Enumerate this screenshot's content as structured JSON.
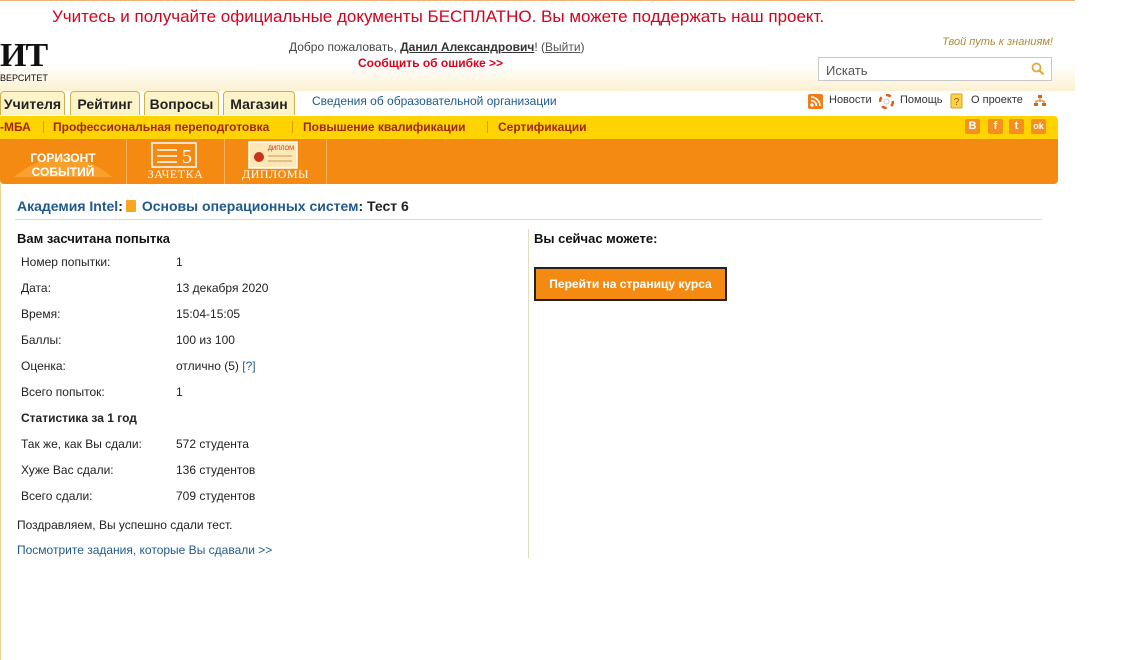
{
  "promo": {
    "text": "Учитесь и получайте официальные документы БЕСПЛАТНО. Вы можете поддержать наш проект."
  },
  "header": {
    "logo_big": "ИТ",
    "logo_small": "ВЕРСИТЕТ",
    "welcome_prefix": "Добро пожаловать, ",
    "user_name": "Данил Александрович",
    "welcome_excl": "! (",
    "logout": "Выйти",
    "welcome_close": ")",
    "report_error": "Сообщить об ошибке >>",
    "motto": "Твой путь к знаниям!",
    "search_placeholder": "Искать",
    "search_icon": "search-icon"
  },
  "tabs": [
    {
      "label": "Учителя"
    },
    {
      "label": "Рейтинг"
    },
    {
      "label": "Вопросы"
    },
    {
      "label": "Магазин"
    }
  ],
  "svedeniya": "Сведения об образовательной организации",
  "toplinks": {
    "news": "Новости",
    "help": "Помощь",
    "about": "О проекте",
    "news_icon": "rss-icon",
    "help_icon": "lifebuoy-icon",
    "about_icon": "info-icon",
    "sitemap_icon": "sitemap-icon"
  },
  "yellow_menu": [
    {
      "label": "-МБА"
    },
    {
      "label": "Профессиональная переподготовка"
    },
    {
      "label": "Повышение квалификации"
    },
    {
      "label": "Сертификации"
    }
  ],
  "social": [
    {
      "label": "В",
      "icon": "vk-icon"
    },
    {
      "label": "f",
      "icon": "facebook-icon"
    },
    {
      "label": "t",
      "icon": "twitter-icon"
    },
    {
      "label": "ok",
      "icon": "odnoklassniki-icon"
    }
  ],
  "orange_menu": {
    "horizon_line1": "ГОРИЗОНТ",
    "horizon_line2": "СОБЫТИЙ",
    "zachetka_number": "5",
    "zachetka": "ЗАЧЕТКА",
    "diplom_badge": "ДИПЛОМ",
    "diplomy": "ДИПЛОМЫ"
  },
  "breadcrumb": {
    "academy": "Академия Intel",
    "colon1": ":",
    "course": "Основы операционных систем",
    "colon2": ":",
    "current": " Тест 6"
  },
  "result": {
    "title": "Вам засчитана попытка",
    "rows": [
      {
        "key": "Номер попытки:",
        "value": "1"
      },
      {
        "key": "Дата:",
        "value": "13 декабря 2020"
      },
      {
        "key": "Время:",
        "value": "15:04-15:05"
      },
      {
        "key": "Баллы:",
        "value": "100 из 100"
      },
      {
        "key": "Оценка:",
        "value": "отлично (5)",
        "help": "[?]"
      },
      {
        "key": "Всего попыток:",
        "value": "1"
      }
    ],
    "stats_title": "Статистика за 1 год",
    "stats": [
      {
        "key": "Так же, как Вы сдали:",
        "value": "572 студента"
      },
      {
        "key": "Хуже Вас сдали:",
        "value": "136 студентов"
      },
      {
        "key": "Всего сдали:",
        "value": "709 студентов"
      }
    ],
    "congrats": "Поздравляем, Вы успешно сдали тест.",
    "view_link": "Посмотрите задания, которые Вы сдавали >>"
  },
  "right": {
    "title": "Вы сейчас можете:",
    "go_button": "Перейти на страницу курса"
  }
}
